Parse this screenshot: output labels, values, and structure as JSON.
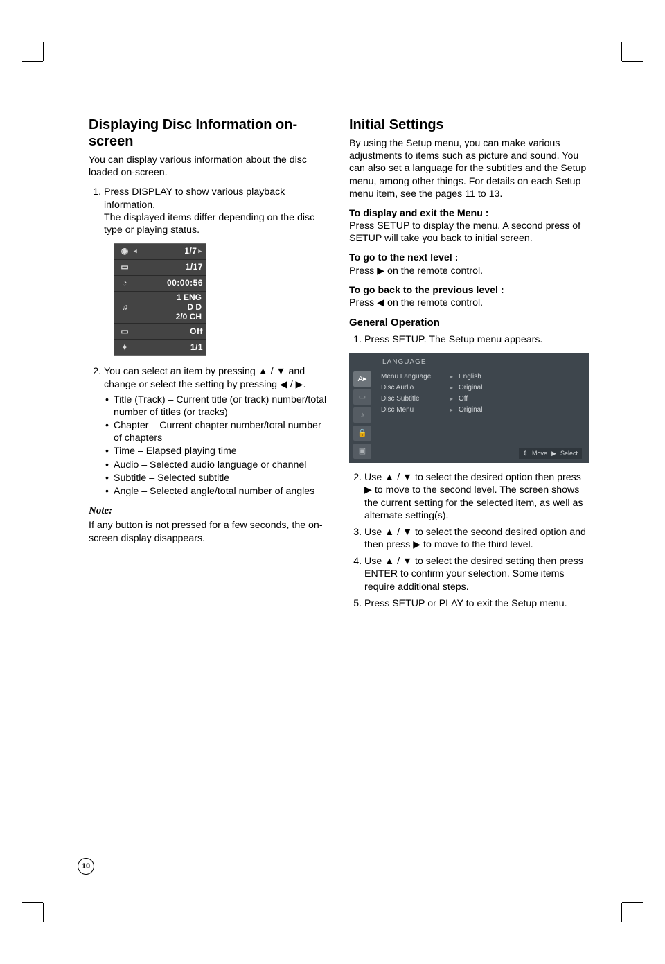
{
  "page_number": "10",
  "left": {
    "heading": "Displaying Disc Information on-screen",
    "intro": "You can display various information about the disc loaded on-screen.",
    "step1a": "Press DISPLAY to show various playback information.",
    "step1b": "The displayed items differ depending on the disc type or playing status.",
    "osd": {
      "title": "1/7",
      "chapter": "1/17",
      "time": "00:00:56",
      "audio_line1": "1 ENG",
      "audio_line2": "D D",
      "audio_line3": "2/0 CH",
      "subtitle": "Off",
      "angle": "1/1"
    },
    "step2": "You can select an item by pressing ▲ / ▼ and change or select the setting by pressing ◀ / ▶.",
    "bullets": {
      "title": "Title (Track) – Current title (or track) number/total number of titles (or tracks)",
      "chapter": "Chapter – Current chapter number/total number of chapters",
      "time": "Time – Elapsed playing time",
      "audio": "Audio – Selected audio language or channel",
      "subtitle": "Subtitle – Selected subtitle",
      "angle": "Angle – Selected angle/total number of angles"
    },
    "note_label": "Note:",
    "note_body": "If any button is not pressed for a few seconds, the on-screen display disappears."
  },
  "right": {
    "heading": "Initial Settings",
    "intro": "By using the Setup menu, you can make various adjustments to items such as picture and sound. You can also set a language for the subtitles and the Setup menu, among other things. For details on each Setup menu item, see the pages 11 to 13.",
    "display_exit_h": "To display and exit the Menu :",
    "display_exit_b": "Press SETUP to display the menu. A second press of SETUP will take you back to initial screen.",
    "next_h": "To go to the next level :",
    "next_b": "Press ▶ on the remote control.",
    "prev_h": "To go back to the previous level :",
    "prev_b": "Press ◀ on the remote control.",
    "genop_h": "General Operation",
    "steps": {
      "s1": "Press SETUP. The Setup menu appears.",
      "s2": "Use ▲ / ▼ to select the desired option then press ▶ to move to the second level. The screen shows the current setting for the selected item, as well as alternate setting(s).",
      "s3": "Use ▲ / ▼ to select the second desired option and then press ▶ to move to the third level.",
      "s4": "Use ▲ / ▼ to select the desired setting then press ENTER to confirm your selection. Some items require additional steps.",
      "s5": "Press SETUP or PLAY to exit the Setup menu."
    },
    "setup_img": {
      "header": "LANGUAGE",
      "items": [
        {
          "label": "Menu Language",
          "val": "English"
        },
        {
          "label": "Disc Audio",
          "val": "Original"
        },
        {
          "label": "Disc Subtitle",
          "val": "Off"
        },
        {
          "label": "Disc Menu",
          "val": "Original"
        }
      ],
      "footer_move": "Move",
      "footer_select": "Select"
    }
  }
}
